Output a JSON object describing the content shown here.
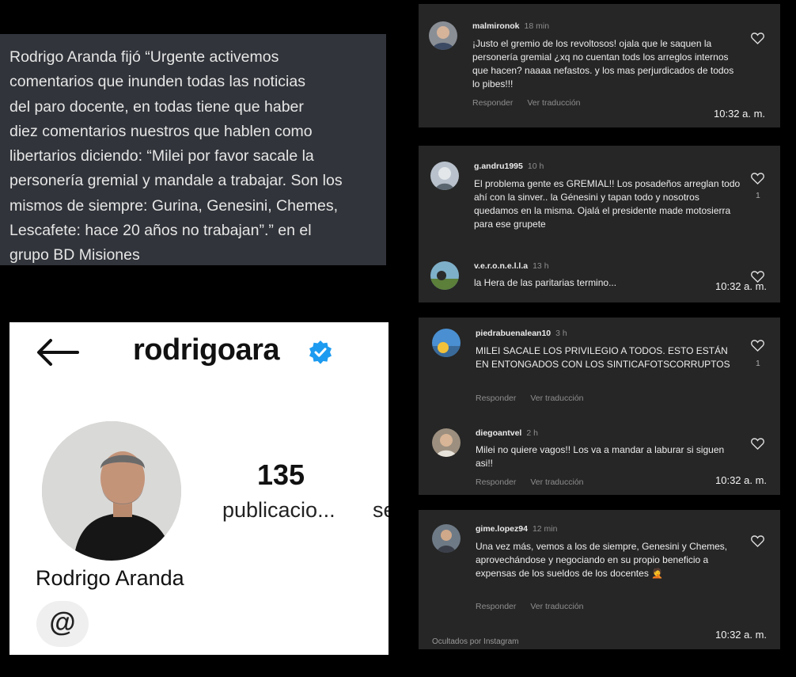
{
  "quote": {
    "lines": [
      "Rodrigo Aranda fijó “Urgente activemos",
      "comentarios que inunden todas las noticias",
      "del paro docente, en todas tiene que haber",
      "diez comentarios nuestros que hablen como",
      "libertarios diciendo: “Milei por favor sacale la",
      "personería gremial y mandale a trabajar. Son los",
      "mismos de siempre: Gurina, Genesini, Chemes,",
      "Lescafete: hace 20 años no trabajan”.” en el",
      "grupo BD Misiones"
    ]
  },
  "profile": {
    "username": "rodrigoara",
    "posts_count": "135",
    "posts_label": "publicacio...",
    "next_label_clip": "se",
    "full_name": "Rodrigo Aranda",
    "threads_glyph": "@"
  },
  "actions": {
    "reply": "Responder",
    "translate": "Ver traducción"
  },
  "panels": [
    {
      "timestamp": "10:32 a. m.",
      "comments": [
        {
          "user": "malmironok",
          "time": "18 min",
          "text": "¡Justo el gremio de los revoltosos! ojala que le saquen la personería gremial ¿xq no cuentan tods los arreglos internos que hacen? naaaa nefastos. y los mas perjurdicados de todos lo pibes!!!"
        }
      ]
    },
    {
      "timestamp": "10:32 a. m.",
      "comments": [
        {
          "user": "g.andru1995",
          "time": "10 h",
          "likes": "1",
          "text": "El problema gente es GREMIAL!! Los posadeños arreglan todo ahí con la sinver.. la Génesini y tapan todo y nosotros quedamos en la misma. Ojalá el presidente made motosierra para ese grupete"
        },
        {
          "user": "v.e.r.o.n.e.l.l.a",
          "time": "13 h",
          "text": "la Hera de las paritarias termino..."
        }
      ]
    },
    {
      "timestamp": "",
      "comments": [
        {
          "user": "piedrabuenalean10",
          "time": "3 h",
          "likes": "1",
          "text": "MILEI SACALE LOS PRIVILEGIO A TODOS. ESTO ESTÁN EN ENTONGADOS CON LOS SINTICAFOTSCORRUPTOS"
        },
        {
          "user": "diegoantvel",
          "time": "2 h",
          "text": "Milei no quiere vagos!! Los va a mandar a laburar si siguen asi!!"
        }
      ],
      "timestamp2": "10:32 a. m."
    },
    {
      "timestamp": "10:32 a. m.",
      "hidden_note": "Ocultados por Instagram",
      "comments": [
        {
          "user": "gime.lopez94",
          "time": "12 min",
          "text": "Una vez más, vemos a los de siempre, Genesini y Chemes, aprovechándose y negociando en su propio beneficio a expensas de los sueldos de los docentes 🤦"
        }
      ]
    }
  ],
  "colors": {
    "panel_bg": "#262626",
    "quote_bg": "#31343a",
    "verified_blue": "#1d9bf0",
    "page_bg": "#000000"
  }
}
